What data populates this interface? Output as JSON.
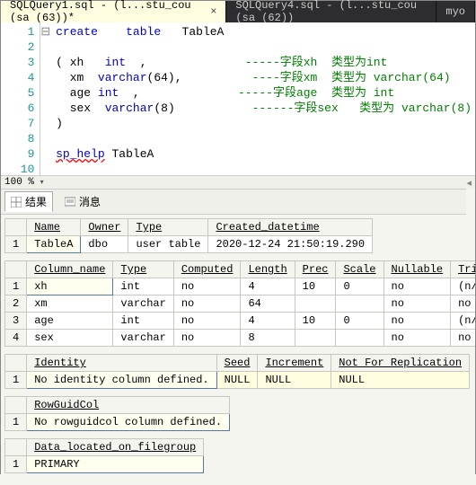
{
  "tabs": [
    {
      "label": "SQLQuery1.sql - (l...stu_cou (sa (63))*",
      "active": true
    },
    {
      "label": "SQLQuery4.sql - (l...stu_cou (sa (62))",
      "active": false
    },
    {
      "label": "myo",
      "active": false
    }
  ],
  "editor": {
    "lines": [
      "1",
      "2",
      "3",
      "4",
      "5",
      "6",
      "7",
      "8",
      "9",
      "10"
    ],
    "code_tokens": [
      [
        [
          "kw",
          "create"
        ],
        [
          "",
          "    "
        ],
        [
          "kw",
          "table"
        ],
        [
          "",
          "   TableA"
        ]
      ],
      [
        [
          "",
          ""
        ]
      ],
      [
        [
          "",
          "( xh   "
        ],
        [
          "typ",
          "int"
        ],
        [
          "",
          "  ,              "
        ],
        [
          "cm",
          "-----字段xh  类型为int"
        ]
      ],
      [
        [
          "",
          "  xm  "
        ],
        [
          "typ",
          "varchar"
        ],
        [
          "",
          "(64),          "
        ],
        [
          "cm",
          "----字段xm  类型为 varchar(64)"
        ]
      ],
      [
        [
          "",
          "  age "
        ],
        [
          "typ",
          "int"
        ],
        [
          "",
          "  ,              "
        ],
        [
          "cm",
          "-----字段age  类型为 int"
        ]
      ],
      [
        [
          "",
          "  sex  "
        ],
        [
          "typ",
          "varchar"
        ],
        [
          "",
          "("
        ],
        [
          "num",
          "8"
        ],
        [
          "",
          ")           "
        ],
        [
          "cm",
          "------字段sex   类型为 varchar(8)"
        ]
      ],
      [
        [
          "",
          ")"
        ]
      ],
      [
        [
          "",
          ""
        ]
      ],
      [
        [
          "kw-redsq",
          "sp_help"
        ],
        [
          "",
          " TableA"
        ]
      ],
      [
        [
          "",
          ""
        ]
      ]
    ]
  },
  "zoom": "100 %",
  "result_tabs": {
    "results": "结果",
    "messages": "消息"
  },
  "grids": {
    "tableinfo": {
      "headers": [
        "Name",
        "Owner",
        "Type",
        "Created_datetime"
      ],
      "rows": [
        [
          "TableA",
          "dbo",
          "user table",
          "2020-12-24 21:50:19.290"
        ]
      ]
    },
    "columns": {
      "headers": [
        "Column_name",
        "Type",
        "Computed",
        "Length",
        "Prec",
        "Scale",
        "Nullable",
        "TrimTrailingB"
      ],
      "rows": [
        [
          "xh",
          "int",
          "no",
          "4",
          "10",
          "0",
          "no",
          "(n/a)"
        ],
        [
          "xm",
          "varchar",
          "no",
          "64",
          "",
          "",
          "no",
          "no"
        ],
        [
          "age",
          "int",
          "no",
          "4",
          "10",
          "0",
          "no",
          "(n/a)"
        ],
        [
          "sex",
          "varchar",
          "no",
          "8",
          "",
          "",
          "no",
          "no"
        ]
      ]
    },
    "identity": {
      "headers": [
        "Identity",
        "Seed",
        "Increment",
        "Not For Replication"
      ],
      "rows": [
        [
          "No identity column defined.",
          "NULL",
          "NULL",
          "NULL"
        ]
      ]
    },
    "rowguid": {
      "headers": [
        "RowGuidCol"
      ],
      "rows": [
        [
          "No rowguidcol column defined."
        ]
      ]
    },
    "filegroup": {
      "headers": [
        "Data_located_on_filegroup"
      ],
      "rows": [
        [
          "PRIMARY"
        ]
      ]
    }
  }
}
